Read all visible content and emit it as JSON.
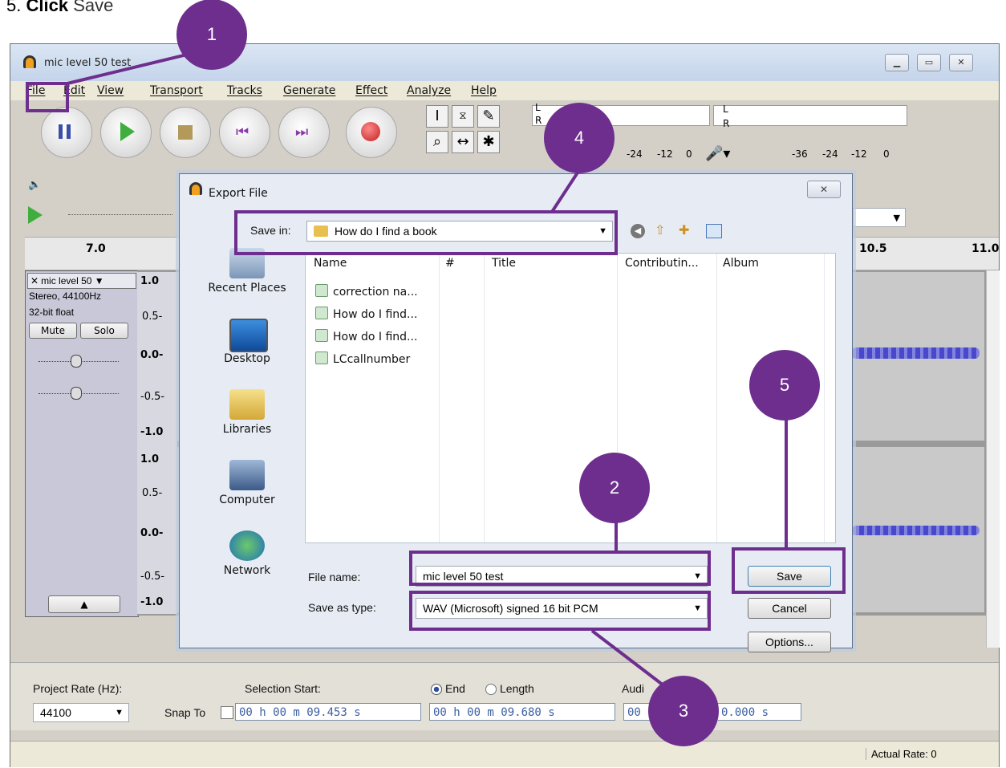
{
  "instruction": {
    "num": "5.",
    "verb": "Click",
    "target": "Save"
  },
  "app": {
    "title": "mic level 50 test",
    "menu": [
      "File",
      "Edit",
      "View",
      "Transport",
      "Tracks",
      "Generate",
      "Effect",
      "Analyze",
      "Help"
    ],
    "meter_ticks_left": [
      "-24",
      "-12",
      "0"
    ],
    "meter_ticks_right": [
      "-36",
      "-24",
      "-12",
      "0"
    ],
    "meter_lr": [
      "L",
      "R"
    ],
    "ruler": [
      "7.0",
      "10.5",
      "11.0"
    ],
    "track": {
      "name": "mic level 50",
      "info1": "Stereo, 44100Hz",
      "info2": "32-bit float",
      "mute": "Mute",
      "solo": "Solo",
      "scale_top": [
        "1.0",
        "0.5-",
        "0.0-",
        "-0.5-",
        "-1.0"
      ],
      "scale_bottom": [
        "1.0",
        "0.5-",
        "0.0-",
        "-0.5-",
        "-1.0"
      ]
    },
    "selection": {
      "project_rate_label": "Project Rate (Hz):",
      "project_rate": "44100",
      "snap_to": "Snap To",
      "sel_start_label": "Selection Start:",
      "end_label": "End",
      "length_label": "Length",
      "audio_label": "Audi",
      "start_value": "00 h 00 m 09.453 s",
      "end_value": "00 h 00 m 09.680 s",
      "audio_value_a": "00",
      "audio_value_b": "0.000 s"
    },
    "status": {
      "actual_rate": "Actual Rate: 0"
    }
  },
  "dialog": {
    "title": "Export File",
    "save_in_label": "Save in:",
    "save_in_value": "How do I find a book",
    "places": [
      "Recent Places",
      "Desktop",
      "Libraries",
      "Computer",
      "Network"
    ],
    "columns": [
      "Name",
      "#",
      "Title",
      "Contributin...",
      "Album"
    ],
    "files": [
      "correction na...",
      "How do I find...",
      "How do I find...",
      "LCcallnumber"
    ],
    "file_name_label": "File name:",
    "file_name_value": "mic level 50 test",
    "save_type_label": "Save as type:",
    "save_type_value": "WAV (Microsoft) signed 16 bit PCM",
    "save_btn": "Save",
    "cancel_btn": "Cancel",
    "options_btn": "Options..."
  },
  "badges": [
    "1",
    "2",
    "3",
    "4",
    "5"
  ],
  "colors": {
    "annotation": "#6d2e8e",
    "wave": "#3a3acc",
    "title_gradient_top": "#dbe6f4"
  }
}
